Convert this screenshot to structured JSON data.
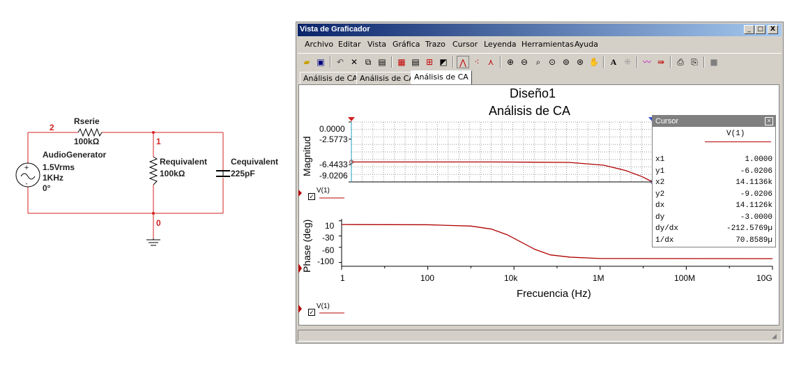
{
  "schematic": {
    "node2": "2",
    "node1": "1",
    "node0": "0",
    "rserie_name": "Rserie",
    "rserie_value": "100kΩ",
    "gen_name": "AudioGenerator",
    "gen_amp": "1.5Vrms",
    "gen_freq": "1KHz",
    "gen_phase": "0°",
    "req_name": "Requivalent",
    "req_value": "100kΩ",
    "ceq_name": "Cequivalent",
    "ceq_value": "225pF"
  },
  "window": {
    "title": "Vista de Graficador",
    "controls": [
      "_",
      "□",
      "X"
    ],
    "menu": [
      "Archivo",
      "Editar",
      "Vista",
      "Gráfica",
      "Trazo",
      "Cursor",
      "Leyenda",
      "Herramientas",
      "Ayuda"
    ],
    "tabs": [
      "Análisis de CA",
      "Análisis de CA",
      "Análisis de CA"
    ],
    "active_tab": 2
  },
  "plot": {
    "title1": "Diseño1",
    "title2": "Análisis de CA",
    "mag_ylabel": "Magnitud",
    "phase_ylabel": "Phase (deg)",
    "xlabel": "Frecuencia (Hz)",
    "trace_label": "V(1)",
    "trace_color": "#b00000"
  },
  "chart_data": [
    {
      "type": "line",
      "title": "Diseño1 Análisis de CA",
      "ylabel": "Magnitud",
      "xscale": "log",
      "xlim": [
        1,
        14113.6
      ],
      "ylim": [
        -9.0206,
        0
      ],
      "yticks": [
        "0.0000",
        "-2.5773",
        "-6.4433",
        "-9.0206"
      ],
      "series": [
        {
          "name": "V(1)",
          "x": [
            1,
            10,
            100,
            1000,
            3000,
            6000,
            10000,
            14113.6
          ],
          "y": [
            -6.0206,
            -6.0206,
            -6.0206,
            -6.08,
            -6.5,
            -7.3,
            -8.2,
            -9.0206
          ]
        }
      ]
    },
    {
      "type": "line",
      "ylabel": "Phase (deg)",
      "xlabel": "Frecuencia (Hz)",
      "xscale": "log",
      "xlim": [
        1,
        10000000000.0
      ],
      "ylim": [
        -110,
        15
      ],
      "yticks": [
        "10",
        "-30",
        "-60",
        "-100"
      ],
      "xticks": [
        "1",
        "100",
        "10k",
        "1M",
        "100M",
        "10G"
      ],
      "series": [
        {
          "name": "V(1)",
          "x": [
            1,
            100,
            1000,
            3000,
            7000,
            14000,
            30000,
            70000,
            200000,
            1000000,
            10000000000.0
          ],
          "y": [
            0,
            -0.5,
            -4,
            -12,
            -27,
            -45,
            -65,
            -80,
            -86,
            -89.5,
            -90
          ]
        }
      ]
    }
  ],
  "cursor": {
    "title": "Cursor",
    "column": "V(1)",
    "rows": [
      {
        "k": "x1",
        "v": "1.0000"
      },
      {
        "k": "y1",
        "v": "-6.0206"
      },
      {
        "k": "x2",
        "v": "14.1136k"
      },
      {
        "k": "y2",
        "v": "-9.0206"
      },
      {
        "k": "dx",
        "v": "14.1126k"
      },
      {
        "k": "dy",
        "v": "-3.0000"
      },
      {
        "k": "dy/dx",
        "v": "-212.5769µ"
      },
      {
        "k": "1/dx",
        "v": "70.8589µ"
      }
    ]
  }
}
